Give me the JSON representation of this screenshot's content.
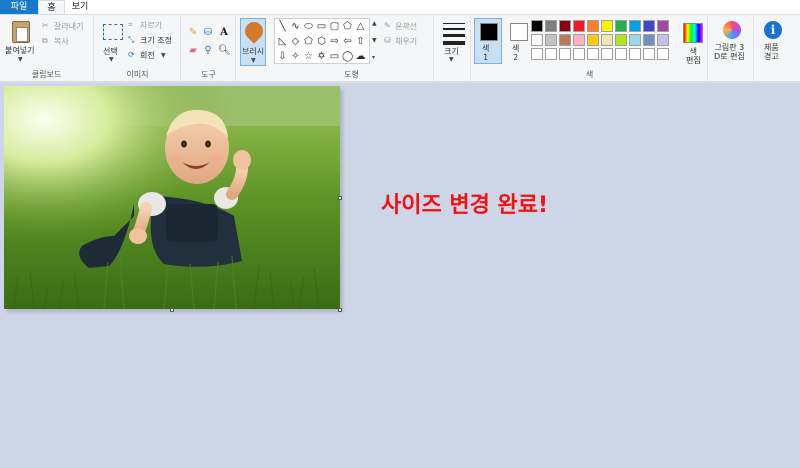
{
  "tabs": {
    "file": "파일",
    "home": "홈",
    "view": "보기"
  },
  "clipboard": {
    "paste": "붙여넣기",
    "cut": "잘라내기",
    "copy": "복사",
    "group": "클립보드"
  },
  "image": {
    "select": "선택",
    "crop": "자르기",
    "resize": "크기 조정",
    "rotate": "회전",
    "group": "이미지"
  },
  "tools": {
    "group": "도구",
    "items": [
      "pencil-icon",
      "fill-icon",
      "text-icon",
      "eraser-icon",
      "color-picker-icon",
      "magnifier-icon"
    ]
  },
  "brush": {
    "label": "브러시"
  },
  "shapes": {
    "outline": "윤곽선",
    "fill": "채우기",
    "group": "도형"
  },
  "size": {
    "label": "크기"
  },
  "colors": {
    "color1": "색\n1",
    "color2": "색\n2",
    "edit": "색\n편집",
    "group": "색",
    "color1_value": "#000000",
    "color2_value": "#ffffff",
    "row1": [
      "#000000",
      "#7f7f7f",
      "#880015",
      "#ed1c24",
      "#ff7f27",
      "#fff200",
      "#22b14c",
      "#00a2e8",
      "#3f48cc",
      "#a349a4"
    ],
    "row2": [
      "#ffffff",
      "#c3c3c3",
      "#b97a57",
      "#ffaec9",
      "#ffc90e",
      "#efe4b0",
      "#b5e61d",
      "#99d9ea",
      "#7092be",
      "#c8bfe7"
    ],
    "row3": [
      "#ffffff",
      "#ffffff",
      "#ffffff",
      "#ffffff",
      "#ffffff",
      "#ffffff",
      "#ffffff",
      "#ffffff",
      "#ffffff",
      "#ffffff"
    ]
  },
  "paint3d": {
    "label": "그림판 3\nD로 편집"
  },
  "alert": {
    "label": "제품\n경고"
  },
  "canvas": {
    "image": "baby-on-grass-photo",
    "caption": "사이즈 변경 완료!",
    "caption_color": "#f40f12"
  }
}
